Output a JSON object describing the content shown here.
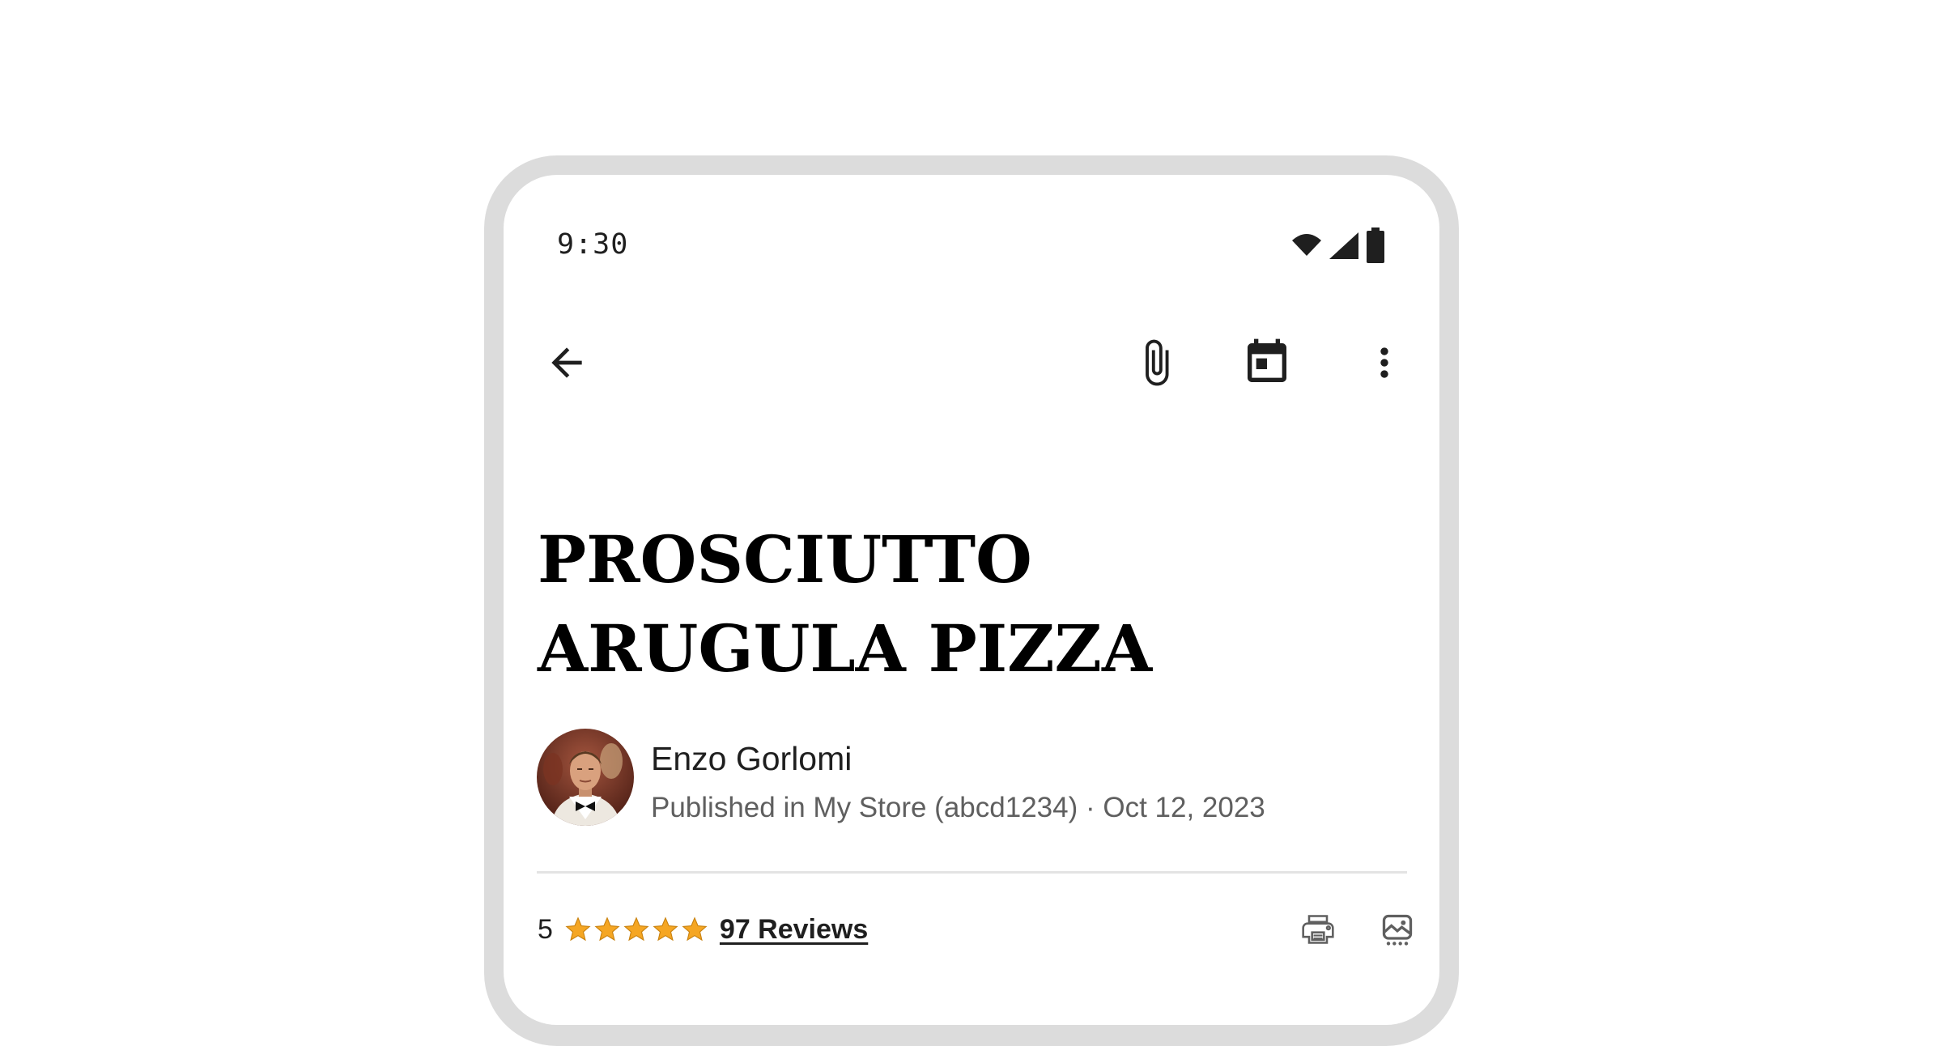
{
  "status_bar": {
    "time": "9:30",
    "icons": [
      "wifi-icon",
      "cellular-signal-icon",
      "battery-icon"
    ]
  },
  "app_bar": {
    "back_icon": "arrow-back-icon",
    "actions": [
      "attachment-icon",
      "calendar-icon",
      "more-vert-icon"
    ]
  },
  "article": {
    "title": "PROSCIUTTO ARUGULA PIZZA",
    "author": {
      "name": "Enzo Gorlomi",
      "byline": "Published in My Store (abcd1234) · Oct 12, 2023",
      "avatar_icon": "author-avatar"
    },
    "rating": {
      "value": "5",
      "stars": 5,
      "star_color": "#f5a623",
      "reviews_label": "97 Reviews"
    },
    "row_actions": [
      "print-icon",
      "image-icon"
    ]
  },
  "colors": {
    "device_frame": "#dcdcdc",
    "text_primary": "#1f1f1f",
    "text_secondary": "#5f5f5f",
    "divider": "#e3e3e3"
  }
}
